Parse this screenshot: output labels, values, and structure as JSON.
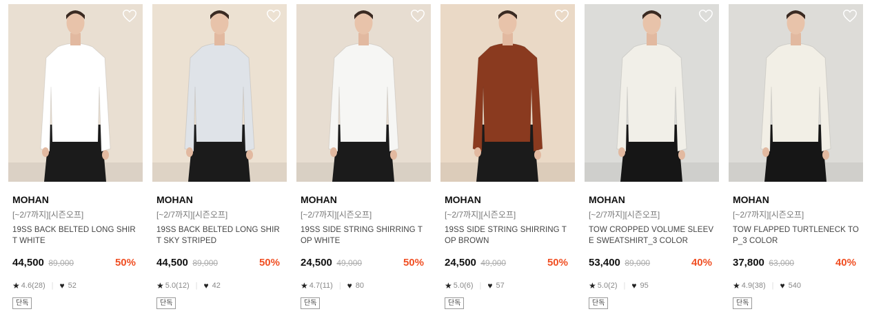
{
  "products": [
    {
      "brand": "MOHAN",
      "promo": "[~2/7까지][시즌오프]",
      "name": "19SS BACK BELTED LONG SHIRT WHITE",
      "price": "44,500",
      "original_price": "89,000",
      "discount": "50%",
      "rating": "4.6(28)",
      "likes": "52",
      "badge": "단독",
      "bg": "#e9dfd2",
      "top_color": "#ffffff",
      "bottom_color": "#1b1b1b"
    },
    {
      "brand": "MOHAN",
      "promo": "[~2/7까지][시즌오프]",
      "name": "19SS BACK BELTED LONG SHIRT SKY STRIPED",
      "price": "44,500",
      "original_price": "89,000",
      "discount": "50%",
      "rating": "5.0(12)",
      "likes": "42",
      "badge": "단독",
      "bg": "#ece1d2",
      "top_color": "#dfe3e8",
      "bottom_color": "#1b1b1b"
    },
    {
      "brand": "MOHAN",
      "promo": "[~2/7까지][시즌오프]",
      "name": "19SS SIDE STRING SHIRRING TOP WHITE",
      "price": "24,500",
      "original_price": "49,000",
      "discount": "50%",
      "rating": "4.7(11)",
      "likes": "80",
      "badge": "단독",
      "bg": "#e7ddd1",
      "top_color": "#f6f6f4",
      "bottom_color": "#1b1b1b"
    },
    {
      "brand": "MOHAN",
      "promo": "[~2/7까지][시즌오프]",
      "name": "19SS SIDE STRING SHIRRING TOP BROWN",
      "price": "24,500",
      "original_price": "49,000",
      "discount": "50%",
      "rating": "5.0(6)",
      "likes": "57",
      "badge": "단독",
      "bg": "#ead9c6",
      "top_color": "#8a3a1f",
      "bottom_color": "#1b1b1b"
    },
    {
      "brand": "MOHAN",
      "promo": "[~2/7까지][시즌오프]",
      "name": "TOW CROPPED VOLUME SLEEVE SWEATSHIRT_3 COLOR",
      "price": "53,400",
      "original_price": "89,000",
      "discount": "40%",
      "rating": "5.0(2)",
      "likes": "95",
      "badge": "단독",
      "bg": "#dcdcd9",
      "top_color": "#f1efe8",
      "bottom_color": "#161616"
    },
    {
      "brand": "MOHAN",
      "promo": "[~2/7까지][시즌오프]",
      "name": "TOW FLAPPED TURTLENECK TOP_3 COLOR",
      "price": "37,800",
      "original_price": "63,000",
      "discount": "40%",
      "rating": "4.9(38)",
      "likes": "540",
      "badge": "단독",
      "bg": "#dddcd8",
      "top_color": "#f2efe6",
      "bottom_color": "#161616"
    }
  ],
  "icons": {
    "wishlist": "heart-outline-icon",
    "rating": "star-icon",
    "likes": "heart-filled-icon"
  }
}
